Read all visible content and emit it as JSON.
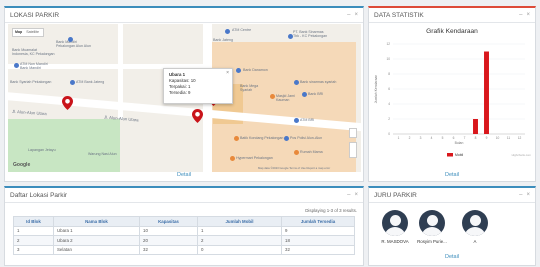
{
  "map_panel": {
    "title": "LOKASI PARKIR",
    "detail_label": "Detail",
    "map_toggle": [
      "Map",
      "Satellite"
    ],
    "popup": {
      "title": "Ubara 1",
      "lines": [
        "Kapasitas: 10",
        "Terpakai: 1",
        "Tersedia: 9"
      ]
    },
    "labels": {
      "atm_centre": "ATM Centre",
      "bank_jateng": "Bank Jateng",
      "pt_bank": "PT. Bank Sinarmas\nTbk - KC Pekalongan",
      "bank_mandiri": "Bank Mandiri\nPekalongan Alun Alun",
      "bank_muamalat": "Bank Muamalat\nIndonesia, KC Pekalongan",
      "atm_mandiri": "ATM Non Mandiri\nBank Mandiri",
      "atm_bank_jateng": "ATM Bank Jateng",
      "bank_syariah": "Bank Syariah Pekalongan",
      "atm_btn": "ATM BTN",
      "bank_danamon": "Bank Danamon",
      "bank_sinarmas": "Bank sinarmas syariah",
      "masjid": "Masjid Jami\nKauman",
      "bank_mega": "Bank Mega\nSyariah",
      "bank_bri": "Bank BRI",
      "bank_syariah_ind": "Bank syariah Indonesia",
      "jl_alun_utara": "Jl. Alun-Alun Utara",
      "jl_alun_barat": "Jl. Alun-Alun Utara",
      "batik": "Batik Kondang Pekalongan",
      "atm_bri": "ATM BRI",
      "bank_btpn": "Bank BTPN",
      "lapangan": "Lapangan Jetayu",
      "pos_polisi": "Pos Polisi Alun-Alun",
      "hypermart": "Hypermart Pekalongan",
      "rumah_mama": "Rumah Mama",
      "puskesmas": "Warung Nasi Alun",
      "lembaga": "Lembaga Bank BPD",
      "google": "Google",
      "attribution": "Map data ©2023 Google  Terms of Use  Report a map error"
    }
  },
  "stats_panel": {
    "title": "DATA STATISTIK",
    "detail_label": "Detail"
  },
  "chart_data": {
    "type": "bar",
    "title": "Grafik Kendaraan",
    "categories": [
      "1",
      "2",
      "3",
      "4",
      "5",
      "6",
      "7",
      "8",
      "9",
      "10",
      "11",
      "12"
    ],
    "series": [
      {
        "name": "Mobil",
        "values": [
          0,
          0,
          0,
          0,
          0,
          0,
          0,
          2,
          11,
          0,
          0,
          0
        ]
      }
    ],
    "ylabel": "Jumlah Kendaraan",
    "xlabel": "Bulan",
    "ylim": [
      0,
      12
    ],
    "colors": {
      "bar": "#d9171c"
    },
    "legend": "bottom",
    "credit": "Highcharts.com"
  },
  "list_panel": {
    "title": "Daftar Lokasi Parkir",
    "showing": "Displaying 1-3 of 3 results.",
    "columns": [
      "Id Blok",
      "Nama Blok",
      "Kapasitas",
      "Jumlah Mobil",
      "Jumlah Tersedia"
    ],
    "rows": [
      [
        "1",
        "Ubara 1",
        "10",
        "1",
        "9"
      ],
      [
        "2",
        "Ubara 2",
        "20",
        "2",
        "18"
      ],
      [
        "3",
        "Selatan",
        "32",
        "0",
        "32"
      ]
    ]
  },
  "staff_panel": {
    "title": "JURU PARKIR",
    "detail_label": "Detail",
    "names": [
      "R. MASDOVA",
      "Rosyim Purie...",
      "A"
    ]
  },
  "colors": {
    "accent": "#3c8dbc",
    "stats_border": "#dd4b39",
    "map_border": "#3c8dbc"
  },
  "controls": {
    "collapse": "–",
    "close": "×"
  }
}
